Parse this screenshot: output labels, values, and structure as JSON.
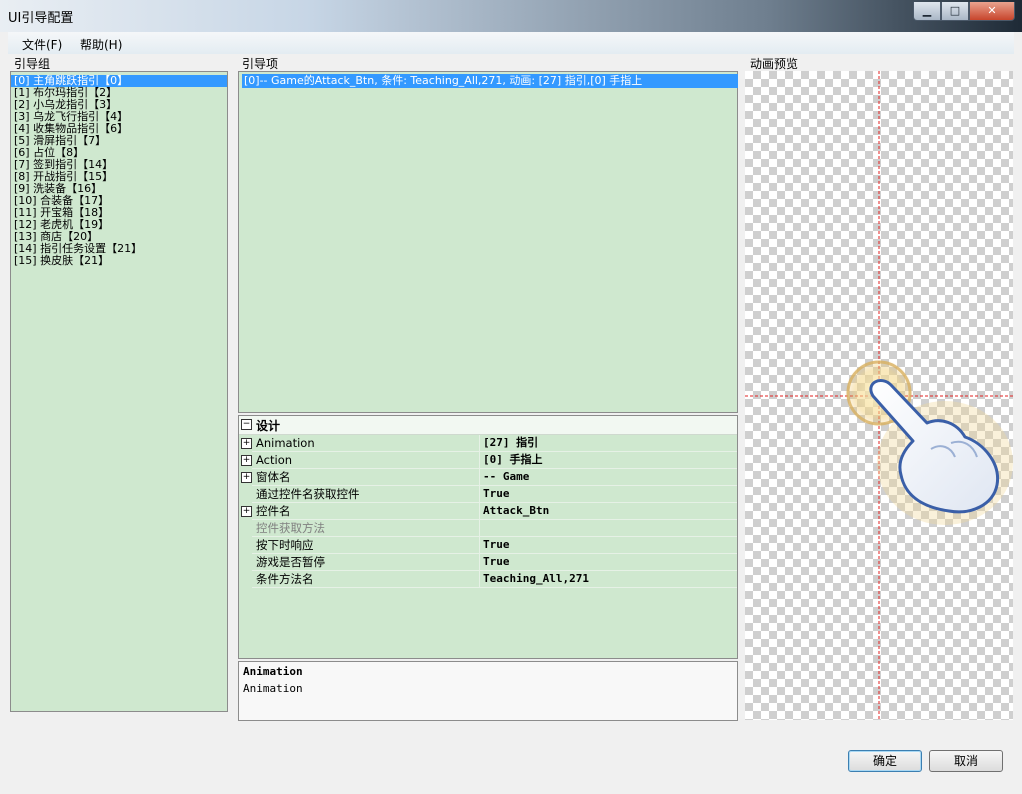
{
  "window": {
    "title": "UI引导配置"
  },
  "menu": [
    {
      "label": "文件(F)"
    },
    {
      "label": "帮助(H)"
    }
  ],
  "groups": {
    "label": "引导组",
    "items": [
      "[0] 主角跳跃指引【0】",
      "[1] 布尔玛指引【2】",
      "[2] 小乌龙指引【3】",
      "[3] 乌龙飞行指引【4】",
      "[4] 收集物品指引【6】",
      "[5] 滑屏指引【7】",
      "[6] 占位【8】",
      "[7] 签到指引【14】",
      "[8] 开战指引【15】",
      "[9] 洗装备【16】",
      "[10] 合装备【17】",
      "[11] 开宝箱【18】",
      "[12] 老虎机【19】",
      "[13] 商店【20】",
      "[14] 指引任务设置【21】",
      "[15] 换皮肤【21】"
    ],
    "selected_index": 0
  },
  "guides": {
    "label": "引导项",
    "items": [
      "[0]-- Game的Attack_Btn, 条件: Teaching_All,271, 动画: [27] 指引,[0] 手指上"
    ]
  },
  "properties": {
    "category": "设计",
    "rows": [
      {
        "name": "Animation",
        "value": "[27] 指引",
        "expand": true
      },
      {
        "name": "Action",
        "value": "[0] 手指上",
        "expand": true
      },
      {
        "name": "窗体名",
        "value": "-- Game",
        "expand": true
      },
      {
        "name": "通过控件名获取控件",
        "value": "True",
        "expand": false
      },
      {
        "name": "控件名",
        "value": "Attack_Btn",
        "expand": true
      },
      {
        "name": "控件获取方法",
        "value": "",
        "expand": false,
        "disabled": true
      },
      {
        "name": "按下时响应",
        "value": "True",
        "expand": false
      },
      {
        "name": "游戏是否暂停",
        "value": "True",
        "expand": false
      },
      {
        "name": "条件方法名",
        "value": "Teaching_All,271",
        "expand": false
      }
    ]
  },
  "description": {
    "title": "Animation",
    "text": "Animation"
  },
  "preview": {
    "label": "动画预览",
    "icon": "pointing-hand-icon",
    "crosshair_color": "#e02020"
  },
  "buttons": {
    "ok": "确定",
    "cancel": "取消"
  }
}
